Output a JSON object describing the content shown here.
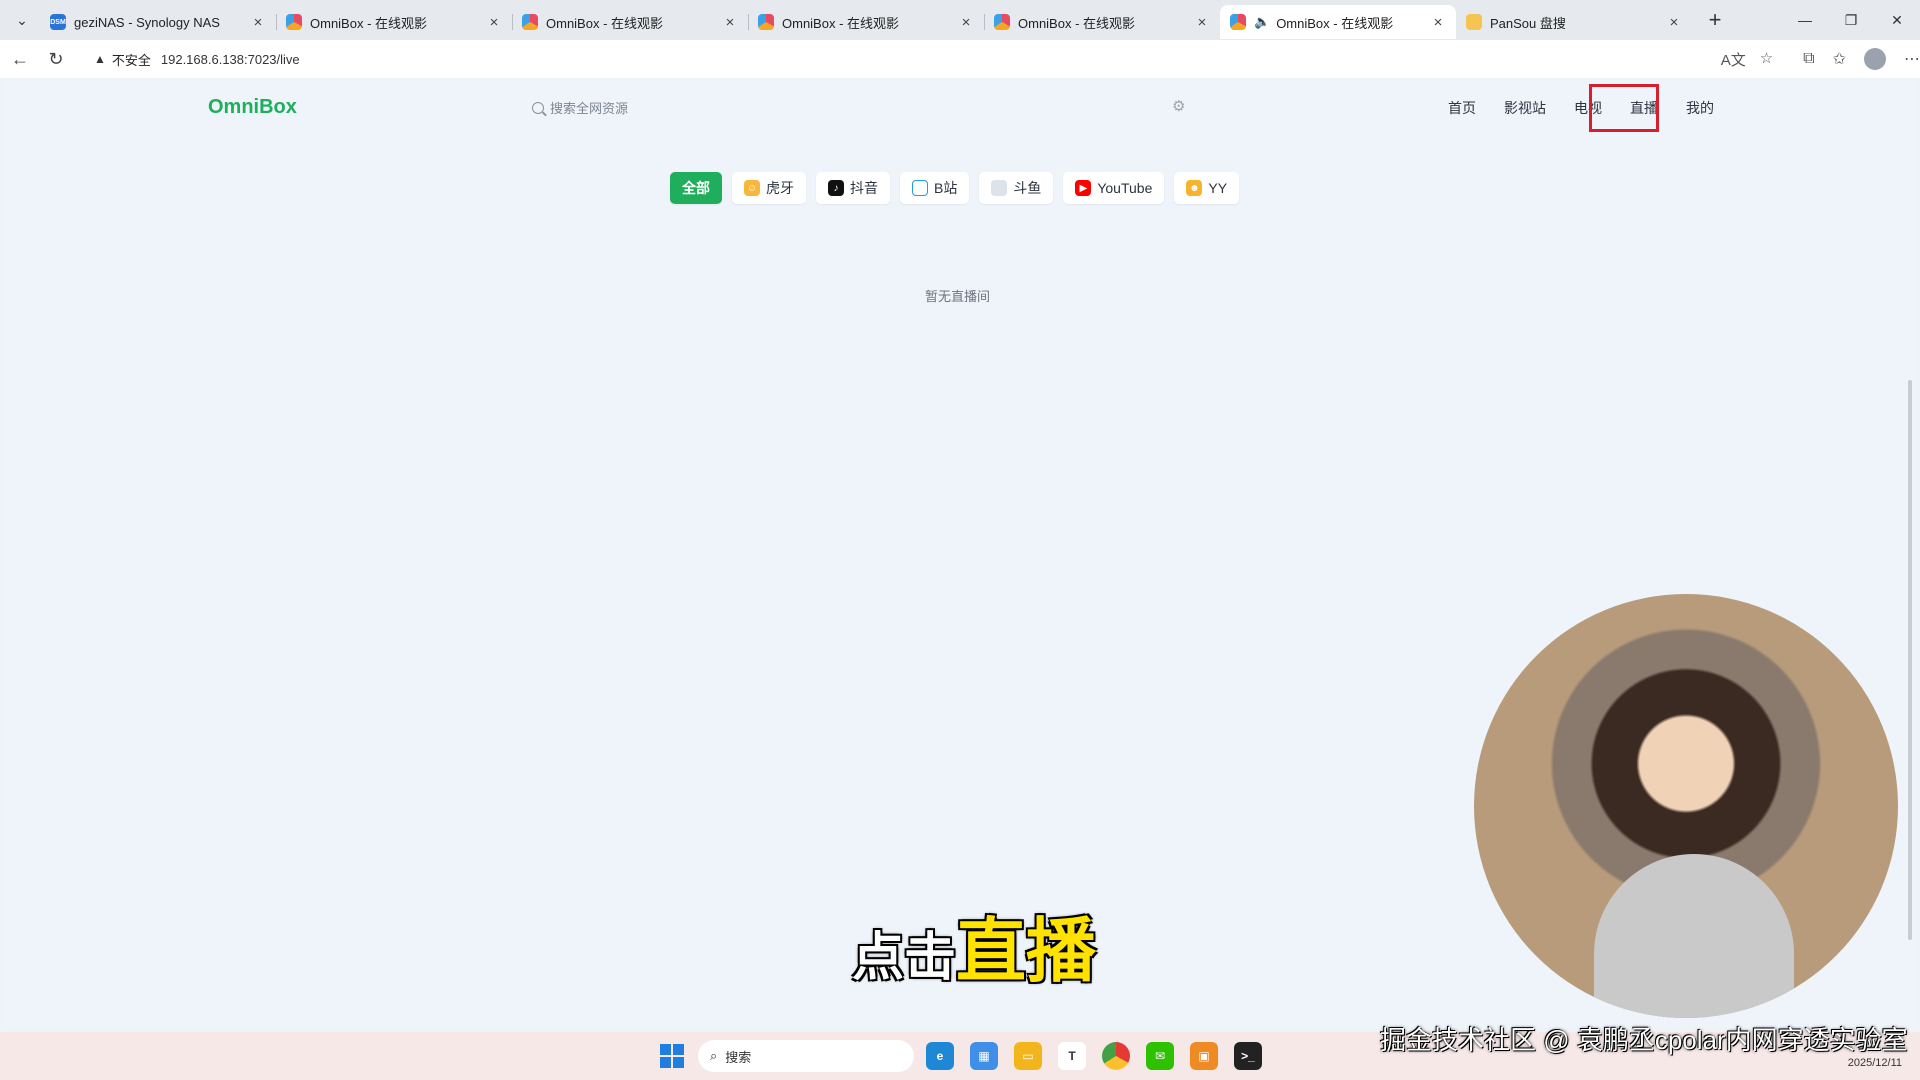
{
  "browser": {
    "tabs": [
      {
        "title": "geziNAS - Synology NAS",
        "favicon": "DSM",
        "active": false
      },
      {
        "title": "OmniBox - 在线观影",
        "favicon": "",
        "active": false
      },
      {
        "title": "OmniBox - 在线观影",
        "favicon": "",
        "active": false
      },
      {
        "title": "OmniBox - 在线观影",
        "favicon": "",
        "active": false
      },
      {
        "title": "OmniBox - 在线观影",
        "favicon": "",
        "active": false
      },
      {
        "title": "OmniBox - 在线观影",
        "favicon": "",
        "active": true,
        "audio": true
      },
      {
        "title": "PanSou 盘搜",
        "favicon": "",
        "active": false
      }
    ],
    "address": {
      "security_label": "不安全",
      "url": "192.168.6.138:7023/live"
    }
  },
  "site": {
    "logo": "OmniBox",
    "search_placeholder": "搜索全网资源",
    "nav": {
      "home": "首页",
      "film": "影视站",
      "tv": "电视",
      "live": "直播",
      "mine": "我的"
    },
    "filters": {
      "all": "全部",
      "huya": "虎牙",
      "douyin": "抖音",
      "bili": "B站",
      "douyu": "斗鱼",
      "youtube": "YouTube",
      "yy": "YY"
    },
    "empty_text": "暂无直播间"
  },
  "overlay": {
    "caption_prefix": "点击",
    "caption_highlight": "直播",
    "watermark": "掘金技术社区 @ 袁鹏丞cpolar内网穿透实验室"
  },
  "taskbar": {
    "search_label": "搜索",
    "date": "2025/12/11"
  },
  "colors": {
    "brand_green": "#1fae5b",
    "highlight_red": "#d61f2c",
    "caption_yellow": "#ffe200"
  }
}
